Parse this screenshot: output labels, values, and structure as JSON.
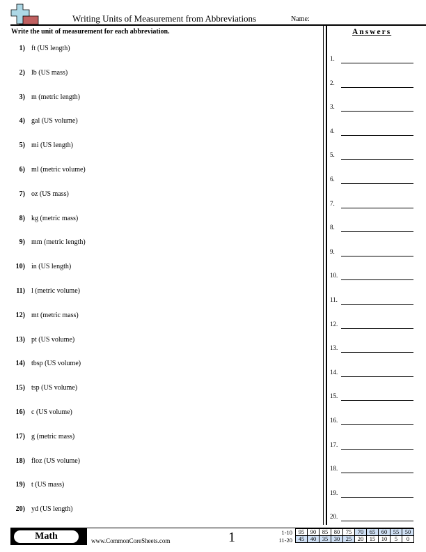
{
  "header": {
    "title": "Writing Units of Measurement from Abbreviations",
    "name_label": "Name:",
    "logo_icon": "plus-minus-logo-icon",
    "colors": {
      "plus": "#add8e6",
      "minus": "#c06060"
    }
  },
  "instructions": "Write the unit of measurement for each abbreviation.",
  "questions": [
    {
      "num": "1)",
      "text": "ft (US length)"
    },
    {
      "num": "2)",
      "text": "lb (US mass)"
    },
    {
      "num": "3)",
      "text": "m (metric length)"
    },
    {
      "num": "4)",
      "text": "gal (US volume)"
    },
    {
      "num": "5)",
      "text": "mi (US length)"
    },
    {
      "num": "6)",
      "text": "ml (metric volume)"
    },
    {
      "num": "7)",
      "text": "oz (US mass)"
    },
    {
      "num": "8)",
      "text": "kg (metric mass)"
    },
    {
      "num": "9)",
      "text": "mm (metric length)"
    },
    {
      "num": "10)",
      "text": "in (US length)"
    },
    {
      "num": "11)",
      "text": "l (metric volume)"
    },
    {
      "num": "12)",
      "text": "mt (metric mass)"
    },
    {
      "num": "13)",
      "text": "pt (US volume)"
    },
    {
      "num": "14)",
      "text": "tbsp (US volume)"
    },
    {
      "num": "15)",
      "text": "tsp (US volume)"
    },
    {
      "num": "16)",
      "text": "c (US volume)"
    },
    {
      "num": "17)",
      "text": "g (metric mass)"
    },
    {
      "num": "18)",
      "text": "floz (US volume)"
    },
    {
      "num": "19)",
      "text": "t (US mass)"
    },
    {
      "num": "20)",
      "text": "yd (US length)"
    }
  ],
  "answers": {
    "title": "Answers",
    "labels": [
      "1.",
      "2.",
      "3.",
      "4.",
      "5.",
      "6.",
      "7.",
      "8.",
      "9.",
      "10.",
      "11.",
      "12.",
      "13.",
      "14.",
      "15.",
      "16.",
      "17.",
      "18.",
      "19.",
      "20."
    ]
  },
  "footer": {
    "subject": "Math",
    "website": "www.CommonCoreSheets.com",
    "page_number": "1",
    "score_table": {
      "shade_color": "#cfe0f5",
      "rows": [
        {
          "label": "1-10",
          "cells": [
            "95",
            "90",
            "85",
            "80",
            "75",
            "70",
            "65",
            "60",
            "55",
            "50"
          ],
          "shaded": [
            false,
            false,
            false,
            false,
            false,
            true,
            true,
            true,
            true,
            true
          ]
        },
        {
          "label": "11-20",
          "cells": [
            "45",
            "40",
            "35",
            "30",
            "25",
            "20",
            "15",
            "10",
            "5",
            "0"
          ],
          "shaded": [
            true,
            true,
            true,
            true,
            true,
            false,
            false,
            false,
            false,
            false
          ]
        }
      ]
    }
  }
}
